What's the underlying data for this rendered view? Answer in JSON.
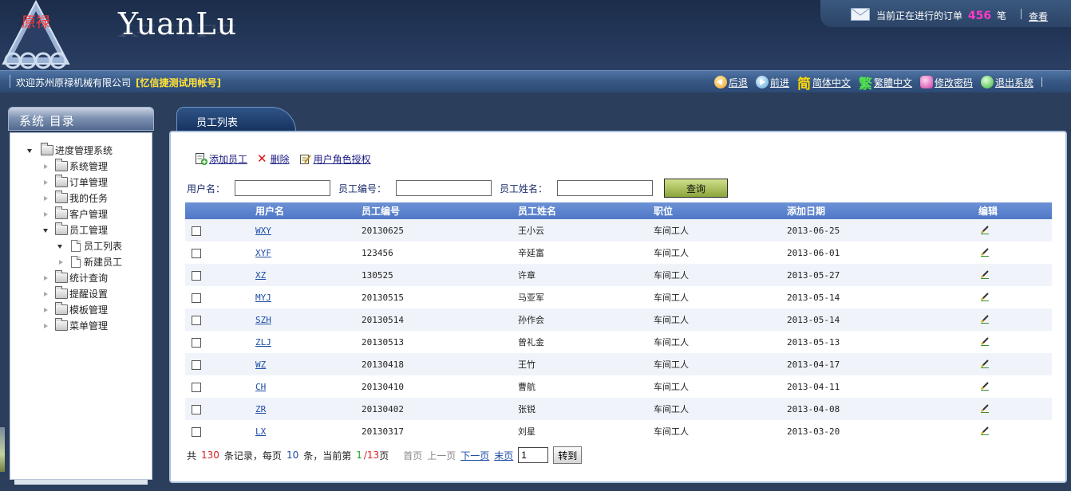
{
  "header": {
    "logo_text": "原禄",
    "brand": "YuanLu",
    "order_prefix": "当前正在进行的订单",
    "order_count": "456",
    "order_unit": "笔",
    "view_link": "查看"
  },
  "welcome": {
    "text": "欢迎苏州原禄机械有限公司",
    "account": "[忆信捷测试用帐号]"
  },
  "topnav": {
    "back": "后退",
    "forward": "前进",
    "simplified": "简体中文",
    "traditional": "繁體中文",
    "change_password": "修改密码",
    "logout": "退出系统",
    "jian_glyph": "简",
    "fan_glyph": "繁"
  },
  "sidebar": {
    "title": "系统 目录",
    "root": "进度管理系统",
    "items": [
      {
        "label": "系统管理"
      },
      {
        "label": "订单管理"
      },
      {
        "label": "我的任务"
      },
      {
        "label": "客户管理"
      },
      {
        "label": "员工管理"
      },
      {
        "label": "员工列表"
      },
      {
        "label": "新建员工"
      },
      {
        "label": "统计查询"
      },
      {
        "label": "提醒设置"
      },
      {
        "label": "模板管理"
      },
      {
        "label": "菜单管理"
      }
    ]
  },
  "main": {
    "tab_label": "员工列表",
    "actions": {
      "add": "添加员工",
      "delete": "删除",
      "auth": "用户角色授权"
    },
    "search": {
      "username_label": "用户名：",
      "empno_label": "员工编号：",
      "name_label": "员工姓名：",
      "username_value": "",
      "empno_value": "",
      "name_value": "",
      "button": "查询"
    },
    "table": {
      "columns": [
        "用户名",
        "员工编号",
        "员工姓名",
        "职位",
        "添加日期",
        "编辑"
      ],
      "rows": [
        {
          "user": "WXY",
          "no": "20130625",
          "name": "王小云",
          "pos": "车间工人",
          "date": "2013-06-25"
        },
        {
          "user": "XYF",
          "no": "123456",
          "name": "辛延富",
          "pos": "车间工人",
          "date": "2013-06-01"
        },
        {
          "user": "XZ",
          "no": "130525",
          "name": "许章",
          "pos": "车间工人",
          "date": "2013-05-27"
        },
        {
          "user": "MYJ",
          "no": "20130515",
          "name": "马亚军",
          "pos": "车间工人",
          "date": "2013-05-14"
        },
        {
          "user": "SZH",
          "no": "20130514",
          "name": "孙作会",
          "pos": "车间工人",
          "date": "2013-05-14"
        },
        {
          "user": "ZLJ",
          "no": "20130513",
          "name": "曾礼金",
          "pos": "车间工人",
          "date": "2013-05-13"
        },
        {
          "user": "WZ",
          "no": "20130418",
          "name": "王竹",
          "pos": "车间工人",
          "date": "2013-04-17"
        },
        {
          "user": "CH",
          "no": "20130410",
          "name": "曹航",
          "pos": "车间工人",
          "date": "2013-04-11"
        },
        {
          "user": "ZR",
          "no": "20130402",
          "name": "张锐",
          "pos": "车间工人",
          "date": "2013-04-08"
        },
        {
          "user": "LX",
          "no": "20130317",
          "name": "刘星",
          "pos": "车间工人",
          "date": "2013-03-20"
        }
      ]
    },
    "pager": {
      "total_prefix": "共",
      "total": "130",
      "total_suffix": "条记录，每页",
      "per_page": "10",
      "per_page_suffix": "条，当前第",
      "current": "1",
      "total_pages": "/13",
      "page_suffix": "页",
      "first": "首页",
      "prev": "上一页",
      "next": "下一页",
      "last": "末页",
      "page_input": "1",
      "go": "转到"
    }
  },
  "colors": {
    "header_bg": "#1c2d4a",
    "table_head": "#5b80cc",
    "order_count": "#ff3ac6",
    "account": "#ffe13a",
    "search_button": "#a8bd55"
  }
}
